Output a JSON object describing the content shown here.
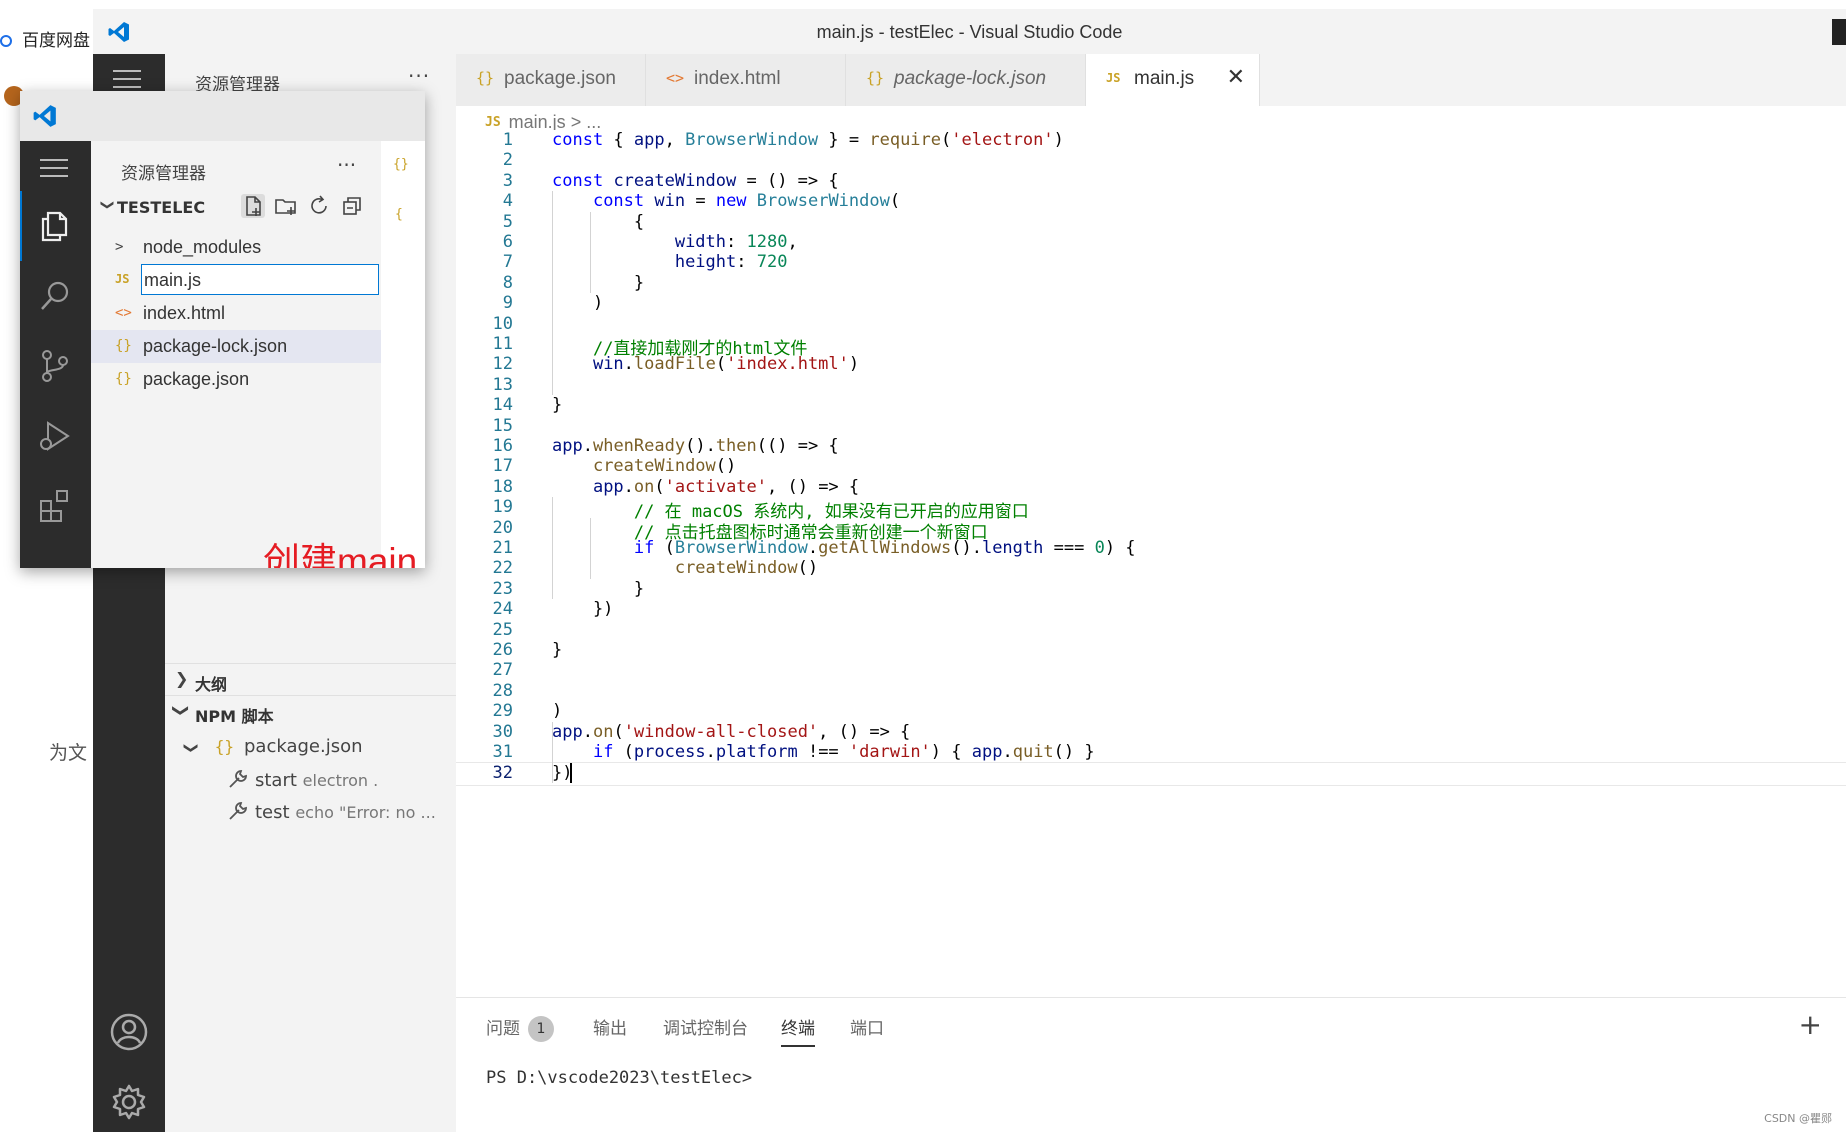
{
  "desktop": {
    "baidu_label": "百度网盘",
    "side_text": "为文"
  },
  "window": {
    "title": "main.js - testElec - Visual Studio Code"
  },
  "sidebar": {
    "title": "资源管理器",
    "more": "···",
    "outline_label": "大纲",
    "npm_label": "NPM 脚本",
    "npm_package": "package.json",
    "scripts": [
      {
        "name": "start",
        "command": "electron ."
      },
      {
        "name": "test",
        "command": "echo \"Error: no ..."
      }
    ]
  },
  "tabs": [
    {
      "icon": "{}",
      "label": "package.json",
      "italic": false
    },
    {
      "icon": "<>",
      "label": "index.html",
      "italic": false
    },
    {
      "icon": "{}",
      "label": "package-lock.json",
      "italic": true
    },
    {
      "icon": "JS",
      "label": "main.js",
      "italic": false,
      "close": "✕"
    }
  ],
  "breadcrumb": {
    "file": "main.js",
    "rest": "> ..."
  },
  "editor": {
    "line_numbers": [
      "1",
      "2",
      "3",
      "4",
      "5",
      "6",
      "7",
      "8",
      "9",
      "10",
      "11",
      "12",
      "13",
      "14",
      "15",
      "16",
      "17",
      "18",
      "19",
      "20",
      "21",
      "22",
      "23",
      "24",
      "25",
      "26",
      "27",
      "28",
      "29",
      "30",
      "31",
      "32"
    ],
    "lines": [
      "const { app, BrowserWindow } = require('electron')",
      "",
      "const createWindow = () => {",
      "    const win = new BrowserWindow(",
      "        {",
      "            width: 1280,",
      "            height: 720",
      "        }",
      "    )",
      "",
      "    //直接加载刚才的html文件",
      "    win.loadFile('index.html')",
      "",
      "}",
      "",
      "app.whenReady().then(() => {",
      "    createWindow()",
      "    app.on('activate', () => {",
      "        // 在 macOS 系统内, 如果没有已开启的应用窗口",
      "        // 点击托盘图标时通常会重新创建一个新窗口",
      "        if (BrowserWindow.getAllWindows().length === 0) {",
      "            createWindow()",
      "        }",
      "    })",
      "",
      "}",
      "",
      "",
      ")",
      "app.on('window-all-closed', () => {",
      "    if (process.platform !== 'darwin') { app.quit() }",
      "})"
    ]
  },
  "panel": {
    "tabs": [
      "问题",
      "输出",
      "调试控制台",
      "终端",
      "端口"
    ],
    "problems_count": "1",
    "active_tab": "终端",
    "prompt": "PS D:\\vscode2023\\testElec>",
    "plus": "+",
    "watermark": "CSDN @瞿郧"
  },
  "overlay": {
    "title": "资源管理器",
    "more": "···",
    "project": "TESTELEC",
    "files": [
      {
        "icon": ">",
        "label": "node_modules",
        "type": "folder"
      },
      {
        "icon": "JS",
        "label": "main.js",
        "type": "js",
        "editing": true
      },
      {
        "icon": "<>",
        "label": "index.html",
        "type": "html"
      },
      {
        "icon": "{}",
        "label": "package-lock.json",
        "type": "json",
        "selected": true
      },
      {
        "icon": "{}",
        "label": "package.json",
        "type": "json"
      }
    ],
    "annotation": "创建main.js"
  },
  "colors": {
    "activity_bar": "#2c2c2c",
    "keyword": "#0000ff",
    "string": "#a31515",
    "number": "#098658",
    "comment": "#008000",
    "annotation": "#e51c23",
    "accent": "#0078d4"
  }
}
